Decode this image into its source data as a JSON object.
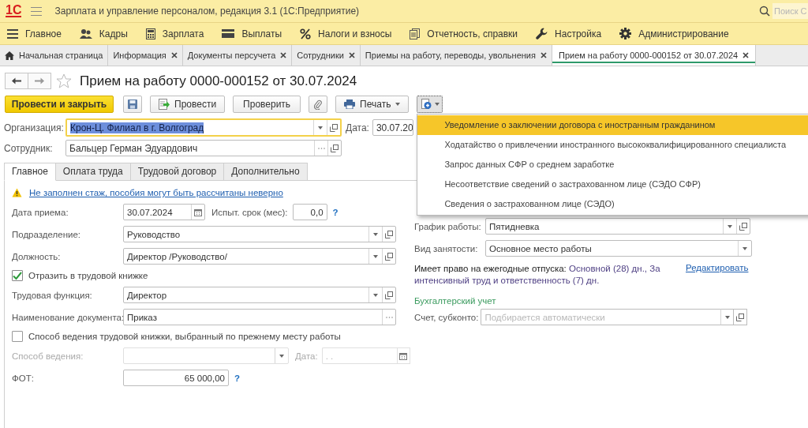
{
  "app": {
    "logo": "1С",
    "title": "Зарплата и управление персоналом, редакция 3.1  (1С:Предприятие)",
    "search_placeholder": "Поиск С"
  },
  "sections": [
    {
      "label": "Главное",
      "kind": "lines"
    },
    {
      "label": "Кадры",
      "kind": "people"
    },
    {
      "label": "Зарплата",
      "kind": "calculator"
    },
    {
      "label": "Выплаты",
      "kind": "card"
    },
    {
      "label": "Налоги и взносы",
      "kind": "percent"
    },
    {
      "label": "Отчетность, справки",
      "kind": "reports"
    },
    {
      "label": "Настройка",
      "kind": "wrench"
    },
    {
      "label": "Администрирование",
      "kind": "gear"
    }
  ],
  "open_tabs": [
    {
      "label": "Начальная страница",
      "kind": "home",
      "selected": false
    },
    {
      "label": "Информация",
      "kind": "page",
      "selected": false
    },
    {
      "label": "Документы персучета",
      "kind": "page",
      "selected": false
    },
    {
      "label": "Сотрудники",
      "kind": "page",
      "selected": false
    },
    {
      "label": "Приемы на работу, переводы, увольнения",
      "kind": "page",
      "selected": false
    },
    {
      "label": "Прием на работу 0000-000152 от 30.07.2024",
      "kind": "page",
      "selected": true
    }
  ],
  "document": {
    "title": "Прием на работу 0000-000152 от 30.07.2024",
    "favorite": false
  },
  "toolbar": [
    {
      "kind": "primary",
      "label": "Провести и закрыть"
    },
    {
      "kind": "save"
    },
    {
      "kind": "post",
      "label": "Провести"
    },
    {
      "kind": "plain",
      "label": "Проверить"
    },
    {
      "kind": "attach"
    },
    {
      "kind": "print",
      "label": "Печать"
    },
    {
      "kind": "create_based",
      "pressed": true
    }
  ],
  "create_menu": {
    "open": true,
    "items": [
      {
        "label": "Уведомление о заключении договора с иностранным гражданином",
        "selected": true
      },
      {
        "label": "Ходатайство о привлечении иностранного высококвалифицированного специалиста",
        "selected": false
      },
      {
        "label": "Запрос данных СФР о среднем заработке",
        "selected": false
      },
      {
        "label": "Несоответствие сведений о застрахованном лице (СЭДО СФР)",
        "selected": false
      },
      {
        "label": "Сведения о застрахованном лице (СЭДО)",
        "selected": false
      }
    ]
  },
  "header": {
    "organization": {
      "label": "Организация:",
      "value": "Крон-Ц. Филиал в г. Волгоград",
      "focused": true,
      "kind": "select_open"
    },
    "date": {
      "label": "Дата:",
      "value": "30.07.20"
    },
    "employee": {
      "label": "Сотрудник:",
      "value": "Бальцер Герман Эдуардович",
      "kind": "choice_open"
    }
  },
  "form_tabs": [
    {
      "label": "Главное",
      "selected": true
    },
    {
      "label": "Оплата труда",
      "selected": false
    },
    {
      "label": "Трудовой договор",
      "selected": false
    },
    {
      "label": "Дополнительно",
      "selected": false
    }
  ],
  "main": {
    "warning": "Не заполнен стаж, пособия могут быть рассчитаны неверно",
    "hire_date": {
      "label": "Дата приема:",
      "value": "30.07.2024",
      "kind": "date"
    },
    "probation": {
      "label": "Испыт. срок (мес):",
      "value": "0,0",
      "help": "?"
    },
    "department": {
      "label": "Подразделение:",
      "value": "Руководство",
      "kind": "select_open"
    },
    "position": {
      "label": "Должность:",
      "value": "Директор /Руководство/",
      "kind": "select_open"
    },
    "labor_book": {
      "label": "Отразить в трудовой книжке",
      "checked": true
    },
    "labor_function": {
      "label": "Трудовая функция:",
      "value": "Директор",
      "kind": "select_open"
    },
    "document_name": {
      "label": "Наименование документа:",
      "value": "Приказ",
      "kind": "choice"
    },
    "previous_method": {
      "label": "Способ ведения трудовой книжки, выбранный по прежнему месту работы",
      "checked": false
    },
    "method": {
      "label": "Способ ведения:",
      "disabled": true,
      "kind": "select"
    },
    "method_date": {
      "label": "Дата:",
      "placeholder": ". .",
      "disabled": true,
      "kind": "date"
    },
    "payroll": {
      "label": "ФОТ:",
      "value": "65 000,00",
      "help": "?"
    }
  },
  "side": {
    "schedule": {
      "label": "График работы:",
      "value": "Пятидневка",
      "kind": "select_open"
    },
    "employment": {
      "label": "Вид занятости:",
      "value": "Основное место работы",
      "kind": "select"
    },
    "vacations": {
      "label": "Имеет право на ежегодные отпуска:",
      "value": "Основной (28) дн., За интенсивный труд и ответственность (7) дн.",
      "link": "Редактировать"
    },
    "accounting": {
      "heading": "Бухгалтерский учет",
      "label": "Счет, субконто:",
      "placeholder": "Подбирается автоматически",
      "kind": "select_open"
    }
  }
}
